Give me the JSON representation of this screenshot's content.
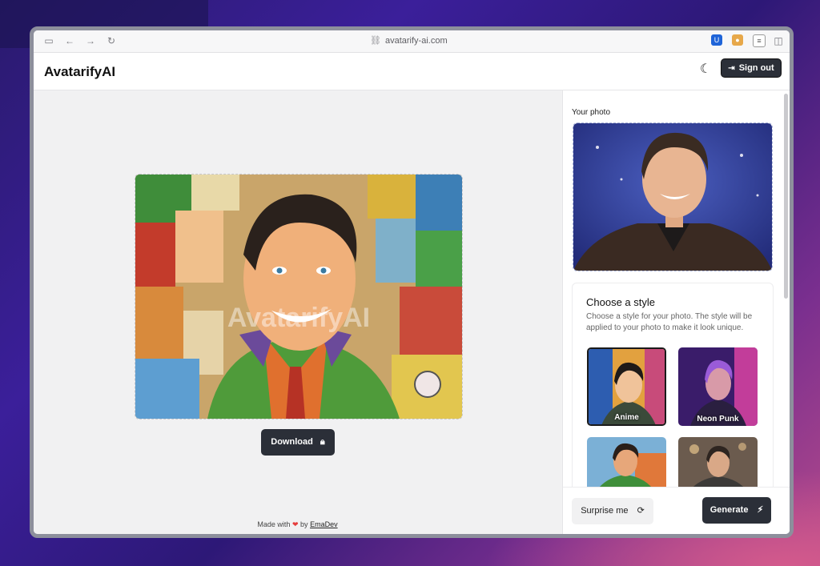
{
  "browser": {
    "url": "avatarify-ai.com"
  },
  "app": {
    "brand": "AvatarifyAI",
    "sign_out_label": "Sign out"
  },
  "result": {
    "watermark": "AvatarifyAI",
    "download_label": "Download"
  },
  "footer": {
    "prefix": "Made with",
    "by": "by",
    "author": "EmaDev"
  },
  "sidebar": {
    "your_photo_label": "Your photo",
    "style_title": "Choose a style",
    "style_description": "Choose a style for your photo. The style will be applied to your photo to make it look unique.",
    "styles": [
      {
        "label": "Anime",
        "selected": true
      },
      {
        "label": "Neon Punk",
        "selected": false
      },
      {
        "label": "",
        "selected": false
      },
      {
        "label": "",
        "selected": false
      }
    ],
    "surprise_label": "Surprise me",
    "generate_label": "Generate"
  },
  "colors": {
    "primary_button": "#2b2f38",
    "heart": "#e53b3b"
  }
}
